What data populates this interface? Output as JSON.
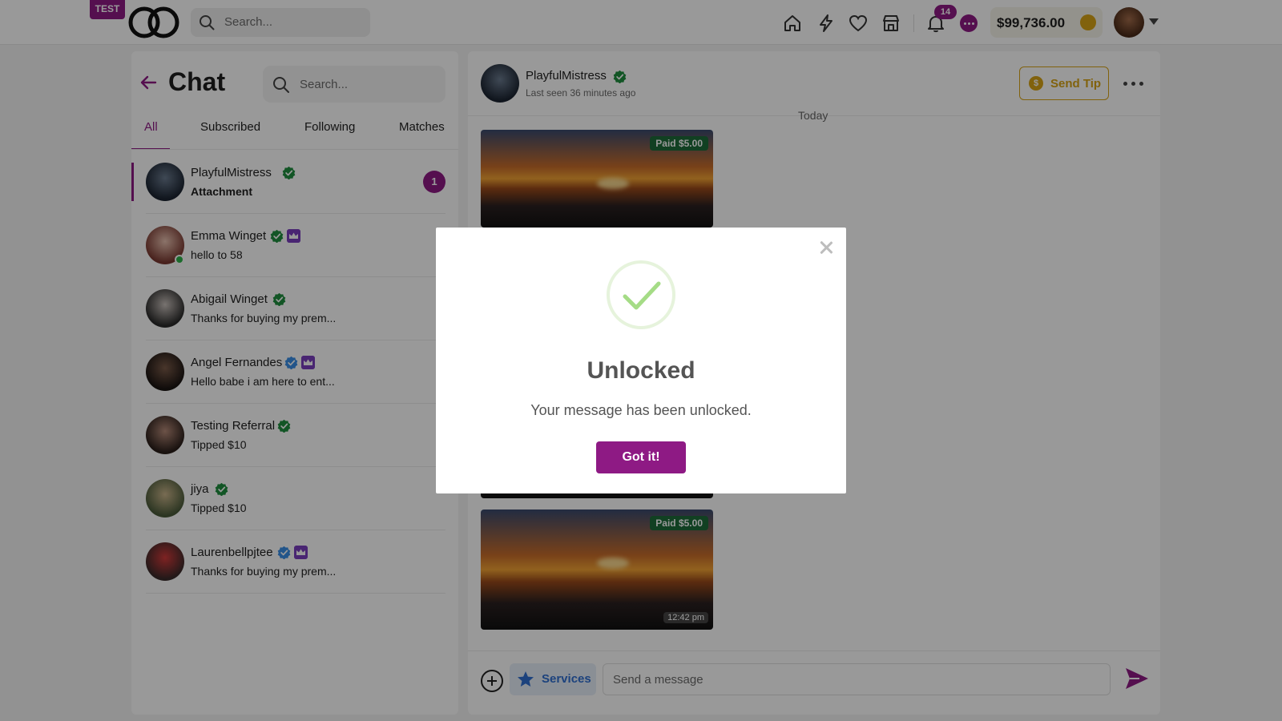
{
  "topbar": {
    "env_badge": "TEST",
    "search_placeholder": "Search...",
    "notifications_count": "14",
    "balance": "$99,736.00",
    "icons": [
      "home-icon",
      "lightning-icon",
      "heart-icon",
      "store-icon",
      "bell-icon",
      "chat-bubble-icon",
      "coin-icon"
    ]
  },
  "chat_list": {
    "title": "Chat",
    "search_placeholder": "Search...",
    "tabs": [
      {
        "label": "All",
        "active": true
      },
      {
        "label": "Subscribed",
        "active": false
      },
      {
        "label": "Following",
        "active": false
      },
      {
        "label": "Matches",
        "active": false
      }
    ],
    "conversations": [
      {
        "name": "PlayfulMistress",
        "message": "Attachment",
        "verified": "green",
        "crown": false,
        "unread": "1",
        "selected": true,
        "online": false
      },
      {
        "name": "Emma Winget",
        "message": "hello to 58",
        "verified": "green",
        "crown": true,
        "unread": "",
        "selected": false,
        "online": true
      },
      {
        "name": "Abigail Winget",
        "message": "Thanks for buying my prem...",
        "verified": "green",
        "crown": false,
        "unread": "",
        "selected": false,
        "online": false
      },
      {
        "name": "Angel Fernandes",
        "message": "Hello babe i am here to ent...",
        "verified": "blue",
        "crown": true,
        "unread": "",
        "selected": false,
        "online": false
      },
      {
        "name": "Testing Referral",
        "message": "Tipped $10",
        "verified": "green",
        "crown": false,
        "unread": "",
        "selected": false,
        "online": false
      },
      {
        "name": "jiya",
        "message": "Tipped $10",
        "verified": "green",
        "crown": false,
        "unread": "",
        "selected": false,
        "online": false
      },
      {
        "name": "Laurenbellpjtee",
        "message": "Thanks for buying my prem...",
        "verified": "blue",
        "crown": true,
        "unread": "",
        "selected": false,
        "online": false
      }
    ]
  },
  "conversation": {
    "name": "PlayfulMistress",
    "last_seen": "Last seen 36 minutes ago",
    "send_tip_label": "Send Tip",
    "day_label": "Today",
    "media": [
      {
        "paid_label": "Paid $5.00",
        "time": ""
      },
      {
        "paid_label": "",
        "time": ""
      },
      {
        "paid_label": "Paid $5.00",
        "time": "12:42 pm"
      }
    ],
    "services_label": "Services",
    "message_placeholder": "Send a message"
  },
  "modal": {
    "title": "Unlocked",
    "text": "Your message has been unlocked.",
    "button_label": "Got it!"
  },
  "colors": {
    "brand": "#8e1a84",
    "gold": "#d8a316",
    "verified_green": "#1e8e3e",
    "verified_blue": "#3a8ee6",
    "success_green": "#a5dc86"
  }
}
